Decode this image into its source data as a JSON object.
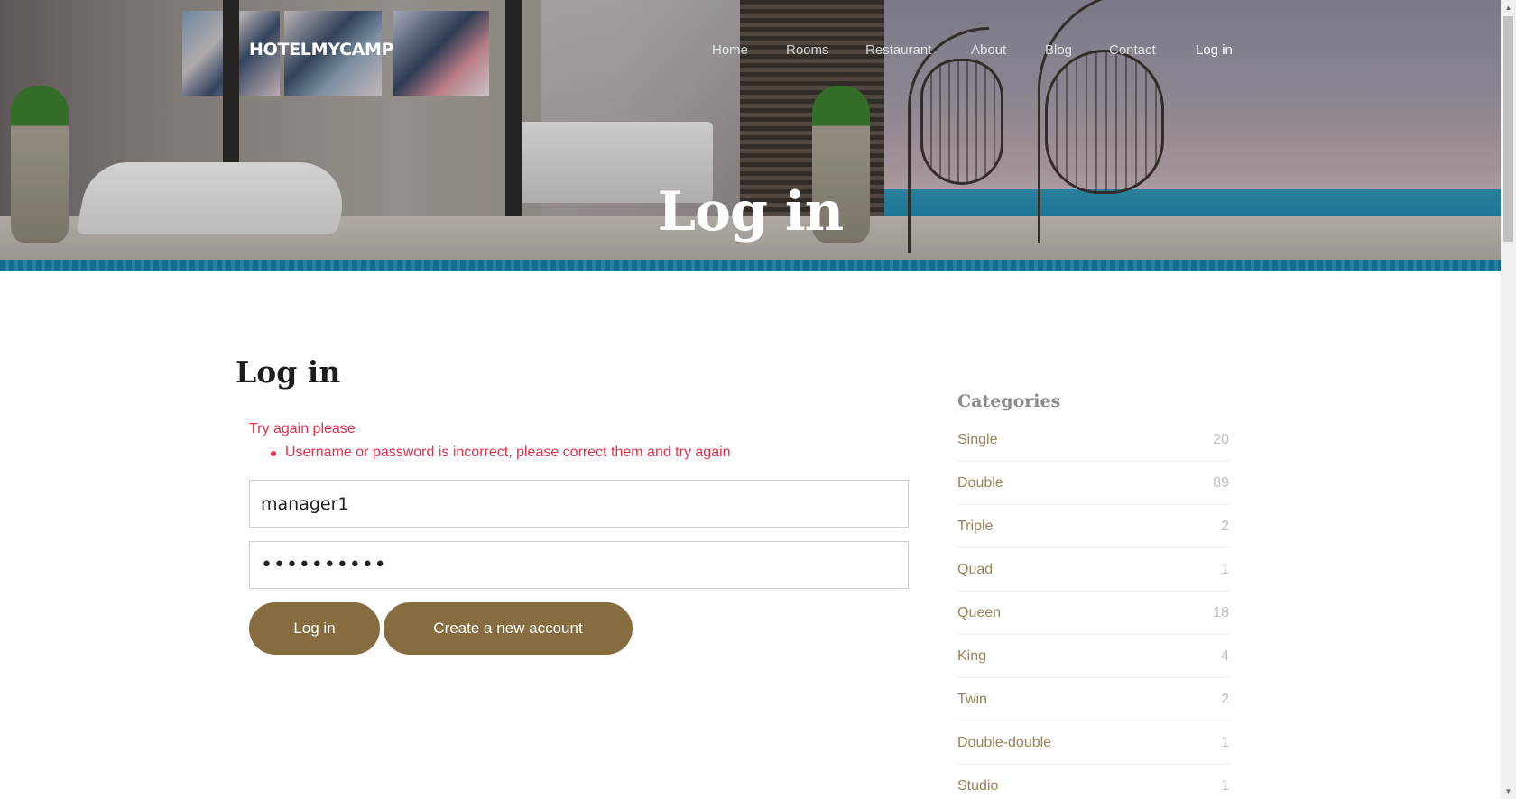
{
  "header": {
    "brand": "HOTELMYCAMP",
    "nav": {
      "home": "Home",
      "rooms": "Rooms",
      "restaurant": "Restaurant",
      "about": "About",
      "blog": "Blog",
      "contact": "Contact",
      "login": "Log in"
    },
    "hero_title": "Log in"
  },
  "main": {
    "title": "Log in",
    "error": {
      "title": "Try again please",
      "items": [
        "Username or password is incorrect, please correct them and try again"
      ]
    },
    "username_value": "manager1",
    "password_value": "••••••••••",
    "buttons": {
      "login": "Log in",
      "create": "Create a new account"
    }
  },
  "sidebar": {
    "title": "Categories",
    "items": [
      {
        "name": "Single",
        "count": "20"
      },
      {
        "name": "Double",
        "count": "89"
      },
      {
        "name": "Triple",
        "count": "2"
      },
      {
        "name": "Quad",
        "count": "1"
      },
      {
        "name": "Queen",
        "count": "18"
      },
      {
        "name": "King",
        "count": "4"
      },
      {
        "name": "Twin",
        "count": "2"
      },
      {
        "name": "Double-double",
        "count": "1"
      },
      {
        "name": "Studio",
        "count": "1"
      }
    ]
  },
  "colors": {
    "accent": "#866c3f",
    "error": "#e0304e",
    "category_link": "#9c8258"
  }
}
